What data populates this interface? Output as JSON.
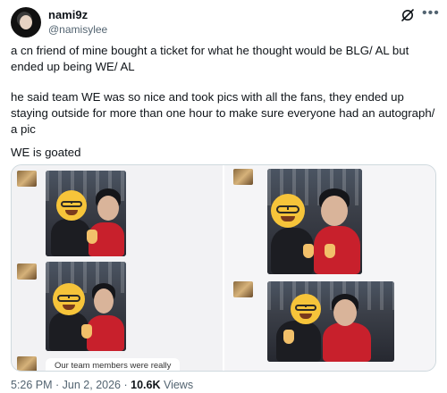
{
  "author": {
    "display_name": "nami9z",
    "handle": "@namisylee"
  },
  "tweet": {
    "paragraphs": [
      "a cn friend of mine bought a ticket for what he thought would be BLG/ AL but ended up being WE/ AL",
      "he said team WE was so nice and took pics with all the fans, they ended up staying outside for more than one hour to make sure everyone had an autograph/ a pic",
      "WE is goated"
    ]
  },
  "media": {
    "chat_snippet": "Our team members were really"
  },
  "meta": {
    "time": "5:26 PM",
    "separator1": " · ",
    "date": "Jun 2, 2026",
    "separator2": " · ",
    "views_count": "10.6K",
    "views_label": " Views"
  },
  "icons": {
    "grok": "grok-icon",
    "more": "more-icon"
  },
  "colors": {
    "text": "#0f1419",
    "secondary": "#536471",
    "border": "#cfd9de"
  }
}
